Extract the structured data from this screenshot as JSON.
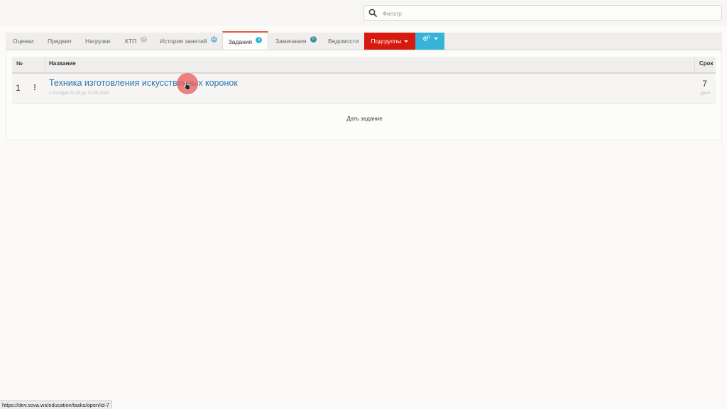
{
  "search": {
    "placeholder": "Фильтр",
    "value": ""
  },
  "tabs": [
    {
      "label": "Оценки"
    },
    {
      "label": "Предмет"
    },
    {
      "label": "Нагрузки"
    },
    {
      "label": "КТП",
      "badge": "0",
      "badge_color": "#c8c8c8"
    },
    {
      "label": "История занятий",
      "badge": "12",
      "badge_color": "#7fb6dc"
    },
    {
      "label": "Задания",
      "badge": "1",
      "badge_color": "#35b3d8",
      "active": true
    },
    {
      "label": "Замечания",
      "badge": "0",
      "badge_color": "#3a8f9c"
    },
    {
      "label": "Ведомости"
    }
  ],
  "subgroups_button": {
    "label": "Подгруппы",
    "color": "#d7190f"
  },
  "settings_button": {
    "icon": "gears-icon",
    "color": "#35b3d8"
  },
  "table": {
    "columns": {
      "num": "№",
      "name": "Название",
      "deadline": "Срок"
    },
    "rows": [
      {
        "num": "1",
        "title": "Техника изготовления искусственных коронок",
        "subtitle": "с Сегодня 11:10 до 17.08.2024",
        "days": "7",
        "days_label": "дней"
      }
    ]
  },
  "give_task_label": "Дать задание",
  "status_url": "https://dev.sova.ws/education/tasks/open/id-7",
  "colors": {
    "accent": "#e9563f",
    "link": "#2a76b4"
  }
}
